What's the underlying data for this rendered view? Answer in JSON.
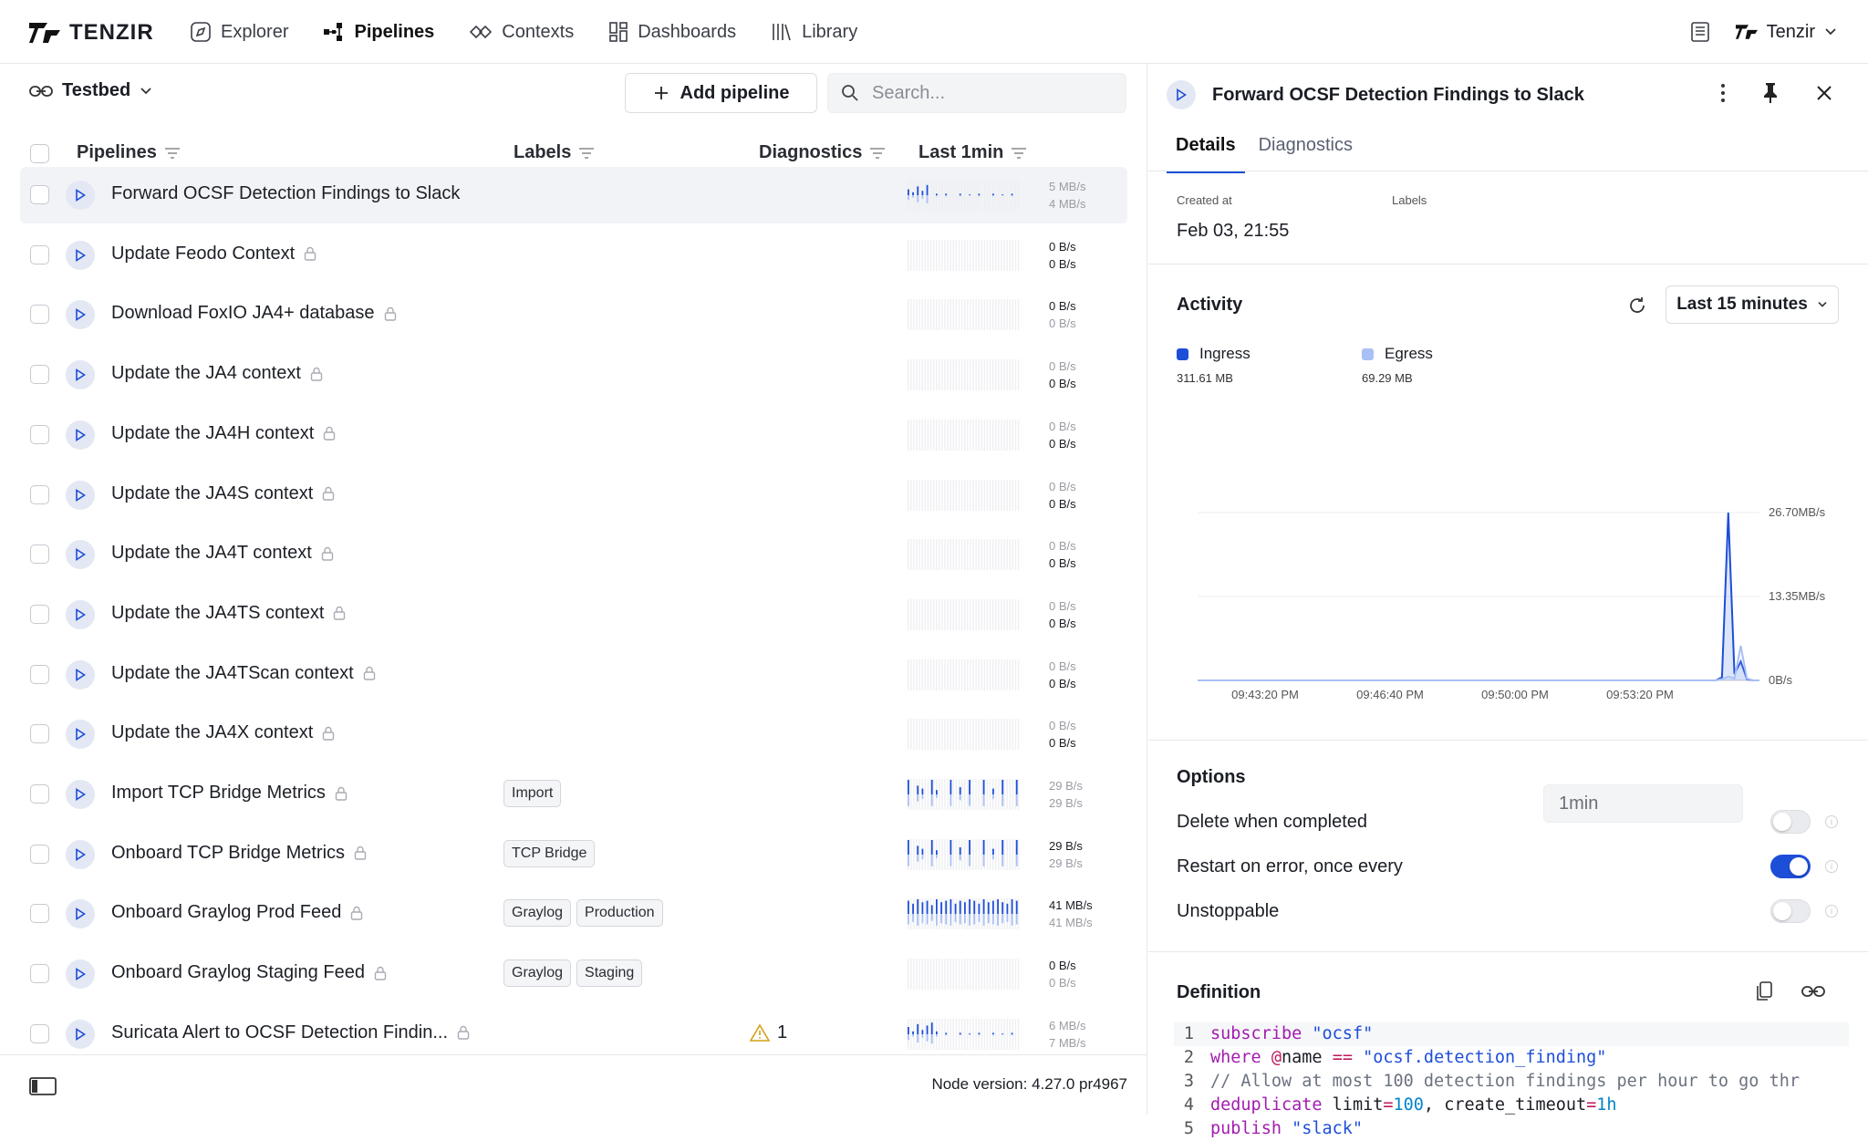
{
  "brand": {
    "name": "TENZIR"
  },
  "nav": [
    {
      "label": "Explorer",
      "icon": "compass-icon",
      "active": false
    },
    {
      "label": "Pipelines",
      "icon": "pipeline-icon",
      "active": true
    },
    {
      "label": "Contexts",
      "icon": "contexts-icon",
      "active": false
    },
    {
      "label": "Dashboards",
      "icon": "dashboard-icon",
      "active": false
    },
    {
      "label": "Library",
      "icon": "library-icon",
      "active": false
    }
  ],
  "workspace": {
    "name": "Tenzir"
  },
  "toolbar": {
    "context": "Testbed",
    "add_label": "Add pipeline",
    "search_placeholder": "Search..."
  },
  "columns": {
    "pipelines": "Pipelines",
    "labels": "Labels",
    "diagnostics": "Diagnostics",
    "last": "Last 1min"
  },
  "pipelines": [
    {
      "name": "Forward OCSF Detection Findings to Slack",
      "locked": false,
      "labels": [],
      "diag": "",
      "in": "5 MB/s",
      "out": "4 MB/s",
      "inBold": false,
      "outBold": false,
      "spark": [
        0.4,
        0.2,
        0.6,
        0.3,
        0.7,
        0,
        0.1,
        0,
        0.1,
        0,
        0,
        0.1,
        0,
        0.05,
        0,
        0.1,
        0,
        0,
        0.1,
        0,
        0.05,
        0,
        0.1,
        0
      ],
      "selected": true
    },
    {
      "name": "Update Feodo Context",
      "locked": true,
      "labels": [],
      "diag": "",
      "in": "0 B/s",
      "out": "0 B/s",
      "inBold": true,
      "outBold": true,
      "spark": []
    },
    {
      "name": "Download FoxIO JA4+ database",
      "locked": true,
      "labels": [],
      "diag": "",
      "in": "0 B/s",
      "out": "0 B/s",
      "inBold": true,
      "outBold": false,
      "spark": []
    },
    {
      "name": "Update the JA4 context",
      "locked": true,
      "labels": [],
      "diag": "",
      "in": "0 B/s",
      "out": "0 B/s",
      "inBold": false,
      "outBold": true,
      "spark": []
    },
    {
      "name": "Update the JA4H context",
      "locked": true,
      "labels": [],
      "diag": "",
      "in": "0 B/s",
      "out": "0 B/s",
      "inBold": false,
      "outBold": true,
      "spark": []
    },
    {
      "name": "Update the JA4S context",
      "locked": true,
      "labels": [],
      "diag": "",
      "in": "0 B/s",
      "out": "0 B/s",
      "inBold": false,
      "outBold": true,
      "spark": []
    },
    {
      "name": "Update the JA4T context",
      "locked": true,
      "labels": [],
      "diag": "",
      "in": "0 B/s",
      "out": "0 B/s",
      "inBold": false,
      "outBold": true,
      "spark": []
    },
    {
      "name": "Update the JA4TS context",
      "locked": true,
      "labels": [],
      "diag": "",
      "in": "0 B/s",
      "out": "0 B/s",
      "inBold": false,
      "outBold": true,
      "spark": []
    },
    {
      "name": "Update the JA4TScan context",
      "locked": true,
      "labels": [],
      "diag": "",
      "in": "0 B/s",
      "out": "0 B/s",
      "inBold": false,
      "outBold": true,
      "spark": []
    },
    {
      "name": "Update the JA4X context",
      "locked": true,
      "labels": [],
      "diag": "",
      "in": "0 B/s",
      "out": "0 B/s",
      "inBold": false,
      "outBold": true,
      "spark": []
    },
    {
      "name": "Import TCP Bridge Metrics",
      "locked": true,
      "labels": [
        "Import"
      ],
      "diag": "",
      "in": "29 B/s",
      "out": "29 B/s",
      "inBold": false,
      "outBold": false,
      "spark": [
        1,
        0,
        0.6,
        0.4,
        0,
        1,
        0.3,
        0,
        0,
        1,
        0,
        0.5,
        0,
        1,
        0,
        0,
        1,
        0,
        0.4,
        0,
        1,
        0,
        0,
        1
      ]
    },
    {
      "name": "Onboard TCP Bridge Metrics",
      "locked": true,
      "labels": [
        "TCP Bridge"
      ],
      "diag": "",
      "in": "29 B/s",
      "out": "29 B/s",
      "inBold": true,
      "outBold": false,
      "spark": [
        1,
        0,
        0.6,
        0.4,
        0,
        1,
        0.3,
        0,
        0,
        1,
        0,
        0.5,
        0,
        1,
        0,
        0,
        1,
        0,
        0.4,
        0,
        1,
        0,
        0,
        1
      ]
    },
    {
      "name": "Onboard Graylog Prod Feed",
      "locked": true,
      "labels": [
        "Graylog",
        "Production"
      ],
      "diag": "",
      "in": "41 MB/s",
      "out": "41 MB/s",
      "inBold": true,
      "outBold": false,
      "spark": [
        0.9,
        0.7,
        1,
        0.8,
        0.9,
        0.6,
        1,
        0.8,
        0.9,
        1,
        0.7,
        0.9,
        0.8,
        1,
        0.9,
        0.7,
        1,
        0.8,
        0.9,
        1,
        0.8,
        0.7,
        1,
        0.9
      ]
    },
    {
      "name": "Onboard Graylog Staging Feed",
      "locked": true,
      "labels": [
        "Graylog",
        "Staging"
      ],
      "diag": "",
      "in": "0 B/s",
      "out": "0 B/s",
      "inBold": true,
      "outBold": false,
      "spark": []
    },
    {
      "name": "Suricata Alert to OCSF Detection Findin...",
      "locked": true,
      "labels": [],
      "diag": "1",
      "in": "6 MB/s",
      "out": "7 MB/s",
      "inBold": false,
      "outBold": false,
      "spark": [
        0.5,
        0.2,
        0.7,
        0.3,
        0.6,
        0.8,
        0.2,
        0,
        0.1,
        0,
        0,
        0.1,
        0,
        0.05,
        0,
        0.1,
        0,
        0,
        0.1,
        0,
        0.05,
        0,
        0.1,
        0
      ]
    }
  ],
  "footer": {
    "version": "Node version: 4.27.0 pr4967"
  },
  "detail": {
    "title": "Forward OCSF Detection Findings to Slack",
    "tabs": [
      "Details",
      "Diagnostics"
    ],
    "created_label": "Created at",
    "created_value": "Feb 03, 21:55",
    "labels_label": "Labels",
    "activity_title": "Activity",
    "range": "Last 15 minutes",
    "ingress_label": "Ingress",
    "ingress_value": "311.61 MB",
    "egress_label": "Egress",
    "egress_value": "69.29 MB",
    "options_title": "Options",
    "opt_delete": "Delete when completed",
    "opt_restart": "Restart on error, once every",
    "opt_restart_value": "1min",
    "opt_unstoppable": "Unstoppable",
    "definition_title": "Definition"
  },
  "colors": {
    "accent": "#1d4ed8",
    "ingress": "#1d4ed8",
    "egress": "#a9c0f5"
  },
  "chart_data": {
    "type": "area",
    "title": "",
    "xlabel": "",
    "ylabel": "",
    "x_ticks": [
      "09:43:20 PM",
      "09:46:40 PM",
      "09:50:00 PM",
      "09:53:20 PM"
    ],
    "y_ticks": [
      "0B/s",
      "13.35MB/s",
      "26.70MB/s"
    ],
    "ylim": [
      0,
      26.7
    ],
    "x": [
      0,
      100,
      200,
      300,
      400,
      500,
      600,
      700,
      800,
      830,
      840,
      850,
      860,
      870,
      880,
      890,
      900
    ],
    "series": [
      {
        "name": "Ingress",
        "values": [
          0,
          0,
          0,
          0,
          0,
          0,
          0,
          0,
          0,
          0,
          0.5,
          26.7,
          1.0,
          3.0,
          0.2,
          0,
          0
        ]
      },
      {
        "name": "Egress",
        "values": [
          0,
          0,
          0,
          0,
          0,
          0,
          0,
          0,
          0,
          0,
          0.2,
          0.6,
          0.3,
          5.5,
          0.3,
          0,
          0
        ]
      }
    ],
    "grid": true,
    "legend": "top-left"
  }
}
